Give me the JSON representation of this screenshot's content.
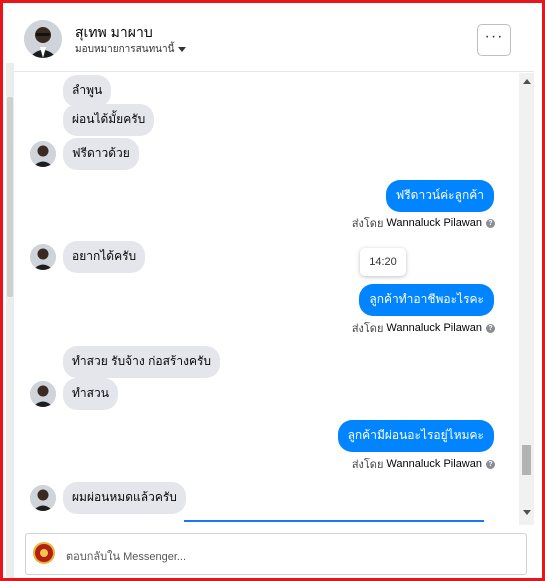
{
  "header": {
    "name": "สุเทพ มาผาบ",
    "subtitle": "มอบหมายการสนทนานี้",
    "more_label": "···"
  },
  "messages": [
    {
      "side": "in",
      "text": "ลำพูน"
    },
    {
      "side": "in",
      "text": "ผ่อนได้มั้ยครับ"
    },
    {
      "side": "in",
      "text": "ฟรีดาวด้วย"
    },
    {
      "side": "out",
      "text": "ฟรีดาวน์ค่ะลูกค้า"
    },
    {
      "side": "in",
      "text": "อยากได้ครับ"
    },
    {
      "side": "out",
      "text": "ลูกค้าทำอาชีพอะไรคะ"
    },
    {
      "side": "in",
      "text": "ทำสวย  รับจ้าง ก่อสร้างครับ"
    },
    {
      "side": "in",
      "text": "ทำสวน"
    },
    {
      "side": "out",
      "text": "ลูกค้ามีผ่อนอะไรอยู่ไหมคะ"
    },
    {
      "side": "in",
      "text": "ผมผ่อนหมดแล้วครับ"
    }
  ],
  "sent_by": {
    "prefix": "ส่งโดย",
    "agent": "Wannaluck Pilawan"
  },
  "timestamp": "14:20",
  "composer": {
    "placeholder": "ตอบกลับใน Messenger..."
  },
  "colors": {
    "outgoing_bubble": "#0084ff",
    "incoming_bubble": "#e4e6eb",
    "frame_border": "#e8161b"
  },
  "icons": [
    "ellipsis-icon",
    "info-icon",
    "page-avatar-icon",
    "chevron-down-icon"
  ]
}
